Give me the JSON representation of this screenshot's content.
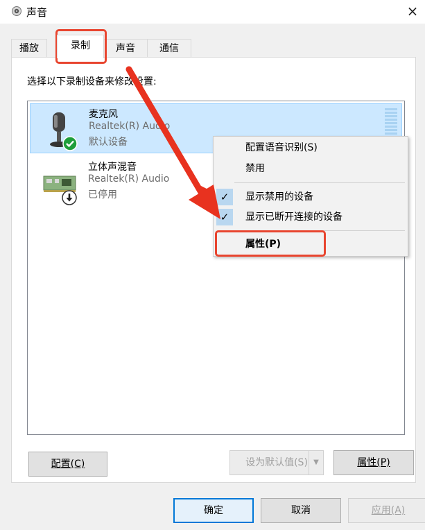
{
  "window": {
    "title": "声音",
    "close_glyph": "×"
  },
  "tabs": [
    {
      "label": "播放"
    },
    {
      "label": "录制"
    },
    {
      "label": "声音"
    },
    {
      "label": "通信"
    }
  ],
  "instruction": "选择以下录制设备来修改设置:",
  "devices": [
    {
      "name": "麦克风",
      "driver": "Realtek(R) Audio",
      "status": "默认设备",
      "selected": true,
      "icon": "microphone-icon",
      "badge": "default-check-icon"
    },
    {
      "name": "立体声混音",
      "driver": "Realtek(R) Audio",
      "status": "已停用",
      "selected": false,
      "icon": "sound-card-icon",
      "badge": "disabled-arrow-icon"
    }
  ],
  "context_menu": {
    "items": [
      {
        "label": "配置语音识别(S)",
        "checked": false
      },
      {
        "label": "禁用",
        "checked": false
      },
      {
        "label": "显示禁用的设备",
        "checked": true
      },
      {
        "label": "显示已断开连接的设备",
        "checked": true
      },
      {
        "label": "属性(P)",
        "checked": false,
        "bold": true
      }
    ]
  },
  "buttons": {
    "configure": "配置(C)",
    "set_default": "设为默认值(S)",
    "properties": "属性(P)",
    "ok": "确定",
    "cancel": "取消",
    "apply": "应用(A)"
  },
  "colors": {
    "annotation": "#e8452f",
    "selection": "#cce8ff",
    "accent": "#0078d7"
  }
}
